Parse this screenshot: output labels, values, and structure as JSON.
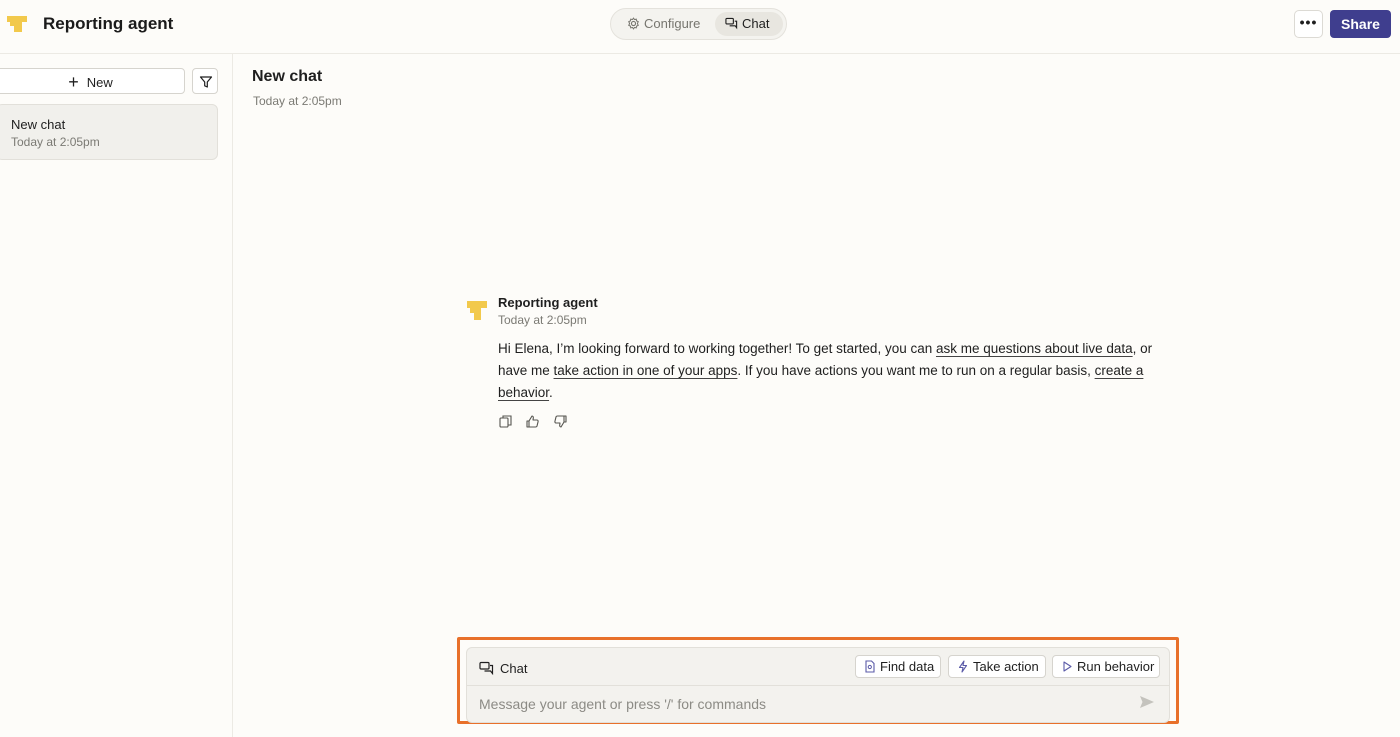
{
  "header": {
    "app_title": "Reporting agent",
    "modes": {
      "configure": "Configure",
      "chat": "Chat",
      "active": "Chat"
    },
    "more_label": "•••",
    "share_label": "Share",
    "accent": "#3f3e8e"
  },
  "sidebar": {
    "new_label": "New",
    "chats": [
      {
        "title": "New chat",
        "time": "Today at 2:05pm"
      }
    ]
  },
  "main": {
    "title": "New chat",
    "time": "Today at 2:05pm",
    "message": {
      "author": "Reporting agent",
      "time": "Today at 2:05pm",
      "t1": "Hi Elena, I’m looking forward to working together! To get started, you can ",
      "link1": "ask me questions about live data",
      "t2": ", or have me ",
      "link2": "take action in one of your apps",
      "t3": ". If you have actions you want me to run on a regular basis, ",
      "link3": "create a behavior",
      "t4": "."
    }
  },
  "composer": {
    "mode_label": "Chat",
    "chips": {
      "find": "Find data",
      "take": "Take action",
      "run": "Run behavior"
    },
    "placeholder": "Message your agent or press '/' for commands",
    "highlight_color": "#e8702a"
  }
}
